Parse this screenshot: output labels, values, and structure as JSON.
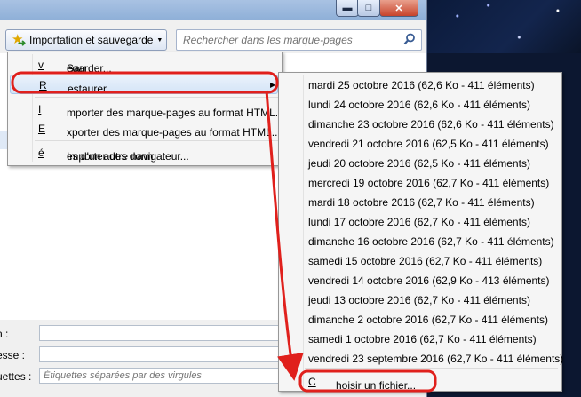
{
  "window": {
    "title_buttons": {
      "minimize": "▬",
      "maximize": "□",
      "close": "✕"
    }
  },
  "toolbar": {
    "organize_label": "Importation et sauvegarde",
    "organize_icon": "import-star-icon",
    "search_placeholder": "Rechercher dans les marque-pages",
    "search_icon": "search-icon"
  },
  "menu": {
    "items": [
      {
        "pre": "Sau",
        "key": "v",
        "post": "egarder..."
      },
      {
        "pre": "",
        "key": "R",
        "post": "estaurer"
      },
      {
        "pre": "",
        "key": "I",
        "post": "mporter des marque-pages au format HTML..."
      },
      {
        "pre": "",
        "key": "E",
        "post": "xporter des marque-pages au format HTML..."
      },
      {
        "pre": "Importer des donn",
        "key": "é",
        "post": "es d'un autre navigateur..."
      }
    ]
  },
  "submenu": {
    "backups": [
      "mardi 25 octobre 2016 (62,6 Ko - 411 éléments)",
      "lundi 24 octobre 2016 (62,6 Ko - 411 éléments)",
      "dimanche 23 octobre 2016 (62,6 Ko - 411 éléments)",
      "vendredi 21 octobre 2016 (62,5 Ko - 411 éléments)",
      "jeudi 20 octobre 2016 (62,5 Ko - 411 éléments)",
      "mercredi 19 octobre 2016 (62,7 Ko - 411 éléments)",
      "mardi 18 octobre 2016 (62,7 Ko - 411 éléments)",
      "lundi 17 octobre 2016 (62,7 Ko - 411 éléments)",
      "dimanche 16 octobre 2016 (62,7 Ko - 411 éléments)",
      "samedi 15 octobre 2016 (62,7 Ko - 411 éléments)",
      "vendredi 14 octobre 2016 (62,9 Ko - 413 éléments)",
      "jeudi 13 octobre 2016 (62,7 Ko - 411 éléments)",
      "dimanche 2 octobre 2016 (62,7 Ko - 411 éléments)",
      "samedi 1 octobre 2016 (62,7 Ko - 411 éléments)",
      "vendredi 23 septembre 2016 (62,7 Ko - 411 éléments)"
    ],
    "choose_file": {
      "pre": "",
      "key": "C",
      "post": "hoisir un fichier..."
    }
  },
  "details": {
    "name_label": "n :",
    "address_label": "esse :",
    "tags_label": "uettes :",
    "tags_placeholder": "Étiquettes séparées par des virgules"
  },
  "colors": {
    "annotation": "#e0201c",
    "highlight": "#d4e4f7"
  }
}
